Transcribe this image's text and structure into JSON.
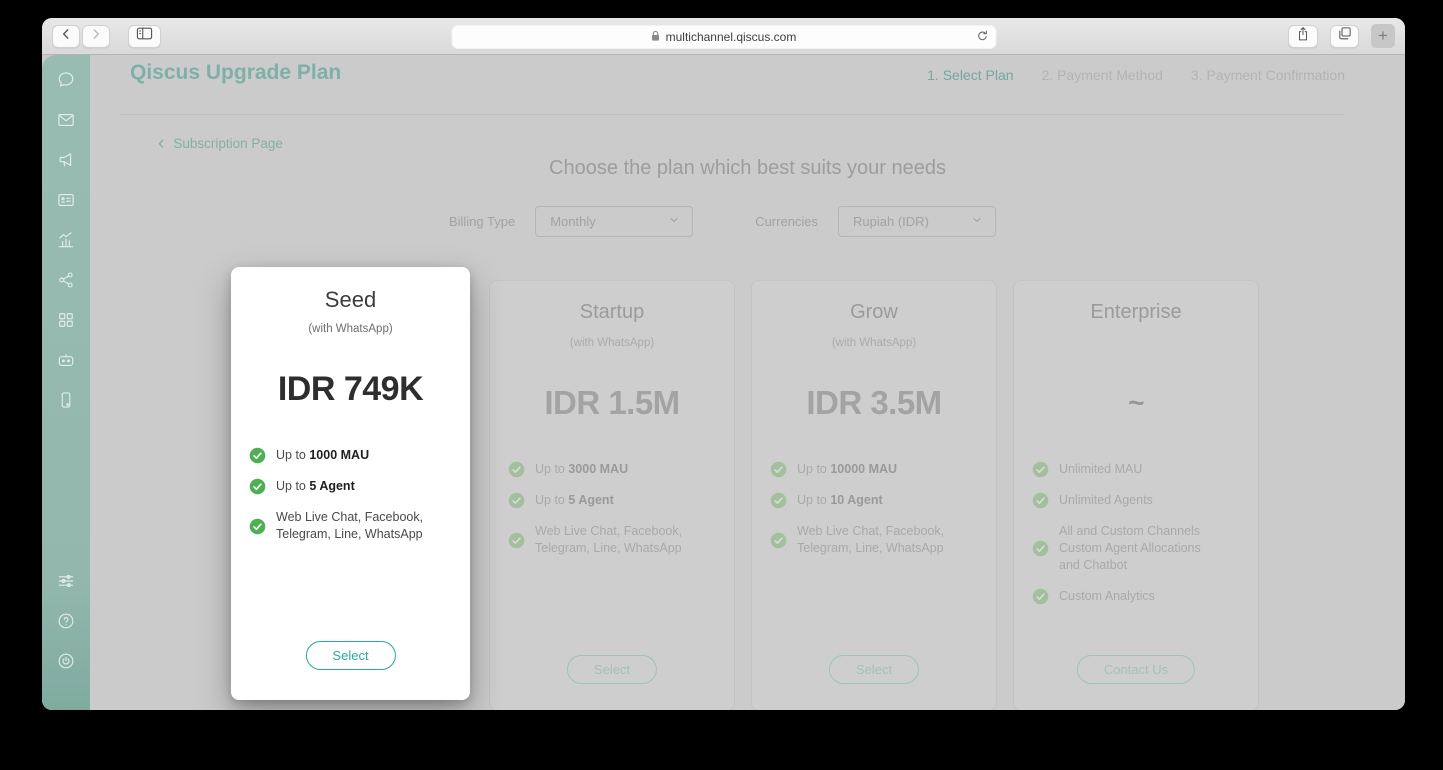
{
  "colors": {
    "brand_teal": "#2aa79b",
    "check_green": "#4db052",
    "sidebar_teal": "#8ab4aa",
    "dim_overlay_bg": "#cbcbcb"
  },
  "browser": {
    "url": "multichannel.qiscus.com",
    "new_tab_label": "+",
    "icons": [
      "back-icon",
      "forward-icon",
      "sidebar-toggle-icon",
      "lock-icon",
      "refresh-icon",
      "share-icon",
      "tabs-icon"
    ]
  },
  "sidebar": {
    "icons": [
      "chat-icon",
      "mail-icon",
      "megaphone-icon",
      "contact-card-icon",
      "analytics-icon",
      "share-nodes-icon",
      "app-grid-icon",
      "bot-icon",
      "mobile-icon",
      "integrations-icon",
      "help-icon",
      "power-icon"
    ]
  },
  "header": {
    "title": "Qiscus Upgrade Plan",
    "steps": [
      {
        "label": "1. Select Plan"
      },
      {
        "label": "2. Payment Method"
      },
      {
        "label": "3. Payment Confirmation"
      }
    ]
  },
  "main": {
    "back_chevron": "‹",
    "back_link": "Subscription Page",
    "heading": "Choose the plan which best suits your needs",
    "billing_type_label": "Billing Type",
    "billing_type_value": "Monthly",
    "currencies_label": "Currencies",
    "currencies_value": "Rupiah (IDR)"
  },
  "cards": [
    {
      "title": "Seed",
      "subtitle": "(with WhatsApp)",
      "price": "IDR 749K",
      "features": [
        {
          "prefix": "Up to ",
          "bold": "1000 MAU"
        },
        {
          "prefix": "Up to ",
          "bold": "5 Agent"
        },
        {
          "prefix": "Web Live Chat, Facebook,\nTelegram, Line, WhatsApp",
          "bold": ""
        }
      ],
      "button": "Select"
    },
    {
      "title": "Startup",
      "subtitle": "(with WhatsApp)",
      "price": "IDR 1.5M",
      "features": [
        {
          "prefix": "Up to ",
          "bold": "3000 MAU"
        },
        {
          "prefix": "Up to ",
          "bold": "5 Agent"
        },
        {
          "prefix": "Web Live Chat, Facebook,\nTelegram, Line, WhatsApp",
          "bold": ""
        }
      ],
      "button": "Select"
    },
    {
      "title": "Grow",
      "subtitle": "(with WhatsApp)",
      "price": "IDR 3.5M",
      "features": [
        {
          "prefix": "Up to ",
          "bold": "10000 MAU"
        },
        {
          "prefix": "Up to ",
          "bold": "10 Agent"
        },
        {
          "prefix": "Web Live Chat, Facebook,\nTelegram, Line, WhatsApp",
          "bold": ""
        }
      ],
      "button": "Select"
    },
    {
      "title": "Enterprise",
      "subtitle": "",
      "price": "~",
      "features": [
        {
          "prefix": "Unlimited MAU",
          "bold": ""
        },
        {
          "prefix": "Unlimited Agents",
          "bold": ""
        },
        {
          "prefix": "All and Custom Channels\nCustom Agent Allocations\nand Chatbot",
          "bold": ""
        },
        {
          "prefix": "Custom Analytics",
          "bold": ""
        }
      ],
      "button": "Contact Us"
    }
  ]
}
